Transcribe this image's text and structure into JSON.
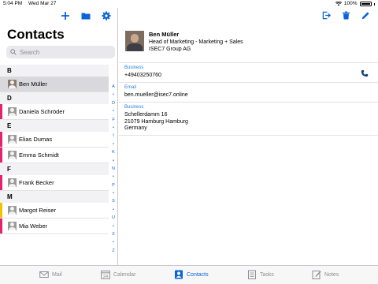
{
  "status": {
    "time": "5:04 PM",
    "date": "Wed Mar 27",
    "battery": "100%"
  },
  "header": {
    "title": "Contacts"
  },
  "search": {
    "placeholder": "Search"
  },
  "sections": [
    {
      "letter": "B",
      "contacts": [
        {
          "name": "Ben Müller",
          "marker": "",
          "selected": true,
          "photo": true
        }
      ]
    },
    {
      "letter": "D",
      "contacts": [
        {
          "name": "Daniela Schröder",
          "marker": "#e5226e"
        }
      ]
    },
    {
      "letter": "E",
      "contacts": [
        {
          "name": "Elias Dumas",
          "marker": "#e5226e"
        },
        {
          "name": "Emma Schmidt",
          "marker": "#e5226e"
        }
      ]
    },
    {
      "letter": "F",
      "contacts": [
        {
          "name": "Frank Becker",
          "marker": "#e5226e"
        }
      ]
    },
    {
      "letter": "M",
      "contacts": [
        {
          "name": "Margot Reiser",
          "marker": "#f2c200"
        },
        {
          "name": "Mia Weber",
          "marker": "#e5226e"
        }
      ]
    }
  ],
  "index_letters": [
    "A",
    "•",
    "D",
    "•",
    "F",
    "•",
    "I",
    "•",
    "K",
    "•",
    "N",
    "•",
    "P",
    "•",
    "S",
    "•",
    "U",
    "•",
    "X",
    "•",
    "Z"
  ],
  "detail": {
    "name": "Ben Müller",
    "title": "Head of Marketing - Marketing + Sales",
    "company": "ISEC7 Group AG",
    "phone_label": "Business",
    "phone": "+49403250760",
    "email_label": "Email",
    "email": "ben.mueller@isec7.online",
    "address_label": "Business",
    "address_street": "Schellerdamm 16",
    "address_city": "21079 Hamburg Hamburg",
    "address_country": "Germany"
  },
  "tabs": [
    {
      "label": "Mail",
      "icon": "mail-icon",
      "active": false
    },
    {
      "label": "Calendar",
      "icon": "calendar-icon",
      "day": "24",
      "active": false
    },
    {
      "label": "Contacts",
      "icon": "contacts-icon",
      "active": true
    },
    {
      "label": "Tasks",
      "icon": "tasks-icon",
      "active": false
    },
    {
      "label": "Notes",
      "icon": "notes-icon",
      "active": false
    }
  ],
  "colors": {
    "accent": "#0a64d6",
    "label_blue": "#2e80d6",
    "marker_pink": "#e5226e",
    "marker_yellow": "#f2c200",
    "selected_row": "#d9d9dd"
  }
}
